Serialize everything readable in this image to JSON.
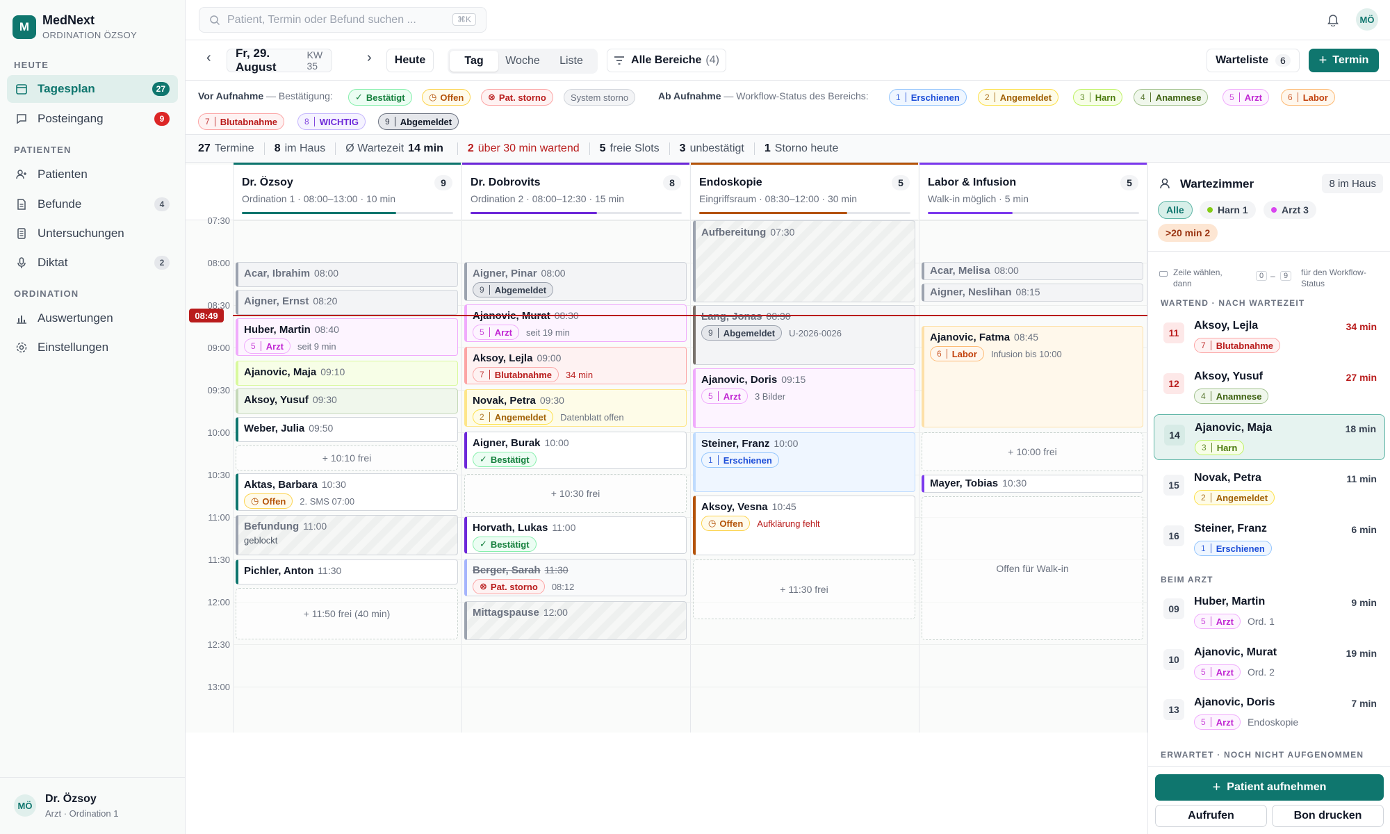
{
  "app": {
    "name": "MedNext",
    "subtitle": "ORDINATION ÖZSOY"
  },
  "sidebar": {
    "sections": [
      "HEUTE",
      "PATIENTEN",
      "ORDINATION"
    ],
    "items": [
      {
        "label": "Tagesplan",
        "count": "27",
        "icon": "calendar-icon"
      },
      {
        "label": "Posteingang",
        "count": "9",
        "icon": "message-icon"
      },
      {
        "label": "Patienten",
        "icon": "users-icon"
      },
      {
        "label": "Befunde",
        "count": "4",
        "icon": "document-icon"
      },
      {
        "label": "Untersuchungen",
        "icon": "clipboard-icon"
      },
      {
        "label": "Diktat",
        "count": "2",
        "icon": "microphone-icon"
      },
      {
        "label": "Auswertungen",
        "icon": "bar-chart-icon"
      },
      {
        "label": "Einstellungen",
        "icon": "gear-icon"
      }
    ],
    "user": {
      "initials": "MÖ",
      "name": "Dr. Özsoy",
      "role": "Arzt · Ordination 1"
    }
  },
  "topbar": {
    "search_placeholder": "Patient, Termin oder Befund suchen ...",
    "shortcut": "⌘K",
    "avatar": "MÖ"
  },
  "toolbar": {
    "prev": "‹",
    "next": "›",
    "date": "Fr, 29. August",
    "week": "KW 35",
    "today": "Heute",
    "views": [
      "Tag",
      "Woche",
      "Liste"
    ],
    "filter_label": "Alle Bereiche",
    "filter_count": "(4)",
    "waitlist_label": "Warteliste",
    "waitlist_count": "6",
    "new_label": "Termin"
  },
  "legend": {
    "before_label": "Vor Aufnahme",
    "before_desc": "— Bestätigung:",
    "before": [
      {
        "label": "Bestätigt",
        "icon": "check-icon"
      },
      {
        "label": "Offen",
        "icon": "clock-icon"
      },
      {
        "label": "Pat. storno",
        "icon": "cancel-icon"
      },
      {
        "label": "System storno"
      }
    ],
    "after_label": "Ab Aufnahme",
    "after_desc": "— Workflow-Status des Bereichs:",
    "after": [
      {
        "n": "1",
        "label": "Erschienen"
      },
      {
        "n": "2",
        "label": "Angemeldet"
      },
      {
        "n": "3",
        "label": "Harn"
      },
      {
        "n": "4",
        "label": "Anamnese"
      },
      {
        "n": "5",
        "label": "Arzt"
      },
      {
        "n": "6",
        "label": "Labor"
      },
      {
        "n": "7",
        "label": "Blutabnahme"
      },
      {
        "n": "8",
        "label": "WICHTIG"
      },
      {
        "n": "9",
        "label": "Abgemeldet"
      }
    ]
  },
  "stats": [
    {
      "v": "27",
      "l": "Termine"
    },
    {
      "v": "8",
      "l": "im Haus"
    },
    {
      "p": "Ø Wartezeit",
      "v": "14 min"
    },
    {
      "v": "2",
      "l": "über 30 min wartend"
    },
    {
      "v": "5",
      "l": "freie Slots"
    },
    {
      "v": "3",
      "l": "unbestätigt"
    },
    {
      "v": "1",
      "l": "Storno heute"
    }
  ],
  "columns": [
    {
      "title": "Dr. Özsoy",
      "sub": "Ordination 1 · 08:00–13:00 · 10 min",
      "count": "9",
      "color": "#0f766e",
      "progress": 0.73
    },
    {
      "title": "Dr. Dobrovits",
      "sub": "Ordination 2 · 08:00–12:30 · 15 min",
      "count": "8",
      "color": "#6d28d9",
      "progress": 0.6
    },
    {
      "title": "Endoskopie",
      "sub": "Eingriffsraum · 08:30–12:00 · 30 min",
      "count": "5",
      "color": "#b45309",
      "progress": 0.7
    },
    {
      "title": "Labor & Infusion",
      "sub": "Walk-in möglich · 5 min",
      "count": "5",
      "color": "#7c3aed",
      "progress": 0.4
    }
  ],
  "times": [
    "07:30",
    "08:00",
    "08:30",
    "09:00",
    "09:30",
    "10:00",
    "10:30",
    "11:00",
    "11:30",
    "12:00",
    "12:30",
    "13:00"
  ],
  "now": "08:49",
  "events": {
    "c0": [
      {
        "name": "Acar, Ibrahim",
        "time": "08:00"
      },
      {
        "name": "Aigner, Ernst",
        "time": "08:20"
      },
      {
        "name": "Huber, Martin",
        "time": "08:40",
        "tag_n": "5",
        "tag": "Arzt",
        "note": "seit 9 min"
      },
      {
        "name": "Ajanovic, Maja",
        "time": "09:10"
      },
      {
        "name": "Aksoy, Yusuf",
        "time": "09:30"
      },
      {
        "name": "Weber, Julia",
        "time": "09:50"
      },
      {
        "free": "+ 10:10 frei"
      },
      {
        "name": "Aktas, Barbara",
        "time": "10:30",
        "tag": "Offen",
        "note": "2. SMS 07:00"
      },
      {
        "name": "Befundung",
        "time": "11:00",
        "note": "geblockt"
      },
      {
        "name": "Pichler, Anton",
        "time": "11:30"
      },
      {
        "free": "+ 11:50 frei (40 min)"
      }
    ],
    "c1": [
      {
        "name": "Aigner, Pinar",
        "time": "08:00",
        "tag_n": "9",
        "tag": "Abgemeldet"
      },
      {
        "name": "Ajanovic, Murat",
        "time": "08:30",
        "tag_n": "5",
        "tag": "Arzt",
        "note": "seit 19 min"
      },
      {
        "name": "Aksoy, Lejla",
        "time": "09:00",
        "tag_n": "7",
        "tag": "Blutabnahme",
        "note": "34 min"
      },
      {
        "name": "Novak, Petra",
        "time": "09:30",
        "tag_n": "2",
        "tag": "Angemeldet",
        "note": "Datenblatt offen"
      },
      {
        "name": "Aigner, Burak",
        "time": "10:00",
        "tag": "Bestätigt"
      },
      {
        "free": "+ 10:30 frei"
      },
      {
        "name": "Horvath, Lukas",
        "time": "11:00",
        "tag": "Bestätigt"
      },
      {
        "name": "Berger, Sarah",
        "time": "11:30",
        "tag": "Pat. storno",
        "note": "08:12"
      },
      {
        "name": "Mittagspause",
        "time": "12:00"
      }
    ],
    "c2": [
      {
        "name": "Aufbereitung",
        "time": "07:30"
      },
      {
        "name": "Lang, Jonas",
        "time": "08:30",
        "tag_n": "9",
        "tag": "Abgemeldet",
        "note": "U-2026-0026"
      },
      {
        "name": "Ajanovic, Doris",
        "time": "09:15",
        "tag_n": "5",
        "tag": "Arzt",
        "note": "3 Bilder"
      },
      {
        "name": "Steiner, Franz",
        "time": "10:00",
        "tag_n": "1",
        "tag": "Erschienen"
      },
      {
        "name": "Aksoy, Vesna",
        "time": "10:45",
        "tag": "Offen",
        "note": "Aufklärung fehlt"
      },
      {
        "free": "+ 11:30 frei"
      }
    ],
    "c3": [
      {
        "name": "Acar, Melisa",
        "time": "08:00"
      },
      {
        "name": "Aigner, Neslihan",
        "time": "08:15"
      },
      {
        "name": "Ajanovic, Fatma",
        "time": "08:45",
        "tag_n": "6",
        "tag": "Labor",
        "note": "Infusion bis 10:00"
      },
      {
        "free": "+ 10:00 frei"
      },
      {
        "name": "Mayer, Tobias",
        "time": "10:30"
      },
      {
        "free": "Offen für Walk-in"
      }
    ]
  },
  "waiting": {
    "title": "Wartezimmer",
    "in_house": "8 im Haus",
    "filters": [
      "Alle",
      "Harn 1",
      "Arzt 3",
      ">20 min 2"
    ],
    "hint_a": "Zeile wählen, dann",
    "hint_k1": "0",
    "hint_dash": "–",
    "hint_k2": "9",
    "hint_b": "für den Workflow-Status",
    "sec_waiting": "WARTEND · NACH WARTEZEIT",
    "waiting": [
      {
        "num": "11",
        "name": "Aksoy, Lejla",
        "tag_n": "7",
        "tag": "Blutabnahme",
        "wait": "34 min"
      },
      {
        "num": "12",
        "name": "Aksoy, Yusuf",
        "tag_n": "4",
        "tag": "Anamnese",
        "wait": "27 min"
      },
      {
        "num": "14",
        "name": "Ajanovic, Maja",
        "tag_n": "3",
        "tag": "Harn",
        "wait": "18 min"
      },
      {
        "num": "15",
        "name": "Novak, Petra",
        "tag_n": "2",
        "tag": "Angemeldet",
        "wait": "11 min"
      },
      {
        "num": "16",
        "name": "Steiner, Franz",
        "tag_n": "1",
        "tag": "Erschienen",
        "wait": "6 min"
      }
    ],
    "sec_doctor": "BEIM ARZT",
    "doctor": [
      {
        "num": "09",
        "name": "Huber, Martin",
        "tag_n": "5",
        "tag": "Arzt",
        "room": "Ord. 1",
        "wait": "9 min"
      },
      {
        "num": "10",
        "name": "Ajanovic, Murat",
        "tag_n": "5",
        "tag": "Arzt",
        "room": "Ord. 2",
        "wait": "19 min"
      },
      {
        "num": "13",
        "name": "Ajanovic, Doris",
        "tag_n": "5",
        "tag": "Arzt",
        "room": "Endoskopie",
        "wait": "7 min"
      }
    ],
    "sec_expected": "ERWARTET · NOCH NICHT AUFGENOMMEN",
    "admit": "Patient aufnehmen",
    "call": "Aufrufen",
    "print": "Bon drucken"
  }
}
